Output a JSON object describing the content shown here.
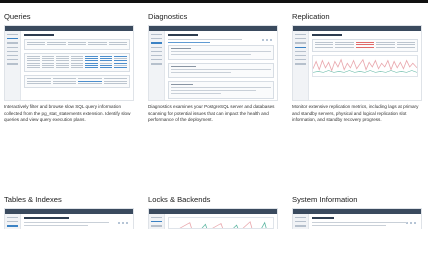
{
  "cards": [
    {
      "id": "queries",
      "title": "Queries",
      "description": "Interactively filter and browse slow SQL query information collected from the pg_stat_statements extension. Identify slow queries and view query execution plans."
    },
    {
      "id": "diagnostics",
      "title": "Diagnostics",
      "description": "Diagnostics examines your PostgreSQL server and databases scanning for potential issues that can impact the health and performance of the deployment."
    },
    {
      "id": "replication",
      "title": "Replication",
      "description": "Monitor extensive replication metrics, including lags at primary and standby servers, physical and logical replication slot information, and standby recovery progress."
    },
    {
      "id": "tables-indexes",
      "title": "Tables & Indexes",
      "description": ""
    },
    {
      "id": "locks-backends",
      "title": "Locks & Backends",
      "description": ""
    },
    {
      "id": "system-information",
      "title": "System Information",
      "description": ""
    }
  ],
  "colors": {
    "topbar": "#3a4a5e",
    "accent": "#3b82c4",
    "chart_pink": "#e9a7ad",
    "chart_teal": "#5fb7a3",
    "alert_red": "#e06a6a"
  }
}
